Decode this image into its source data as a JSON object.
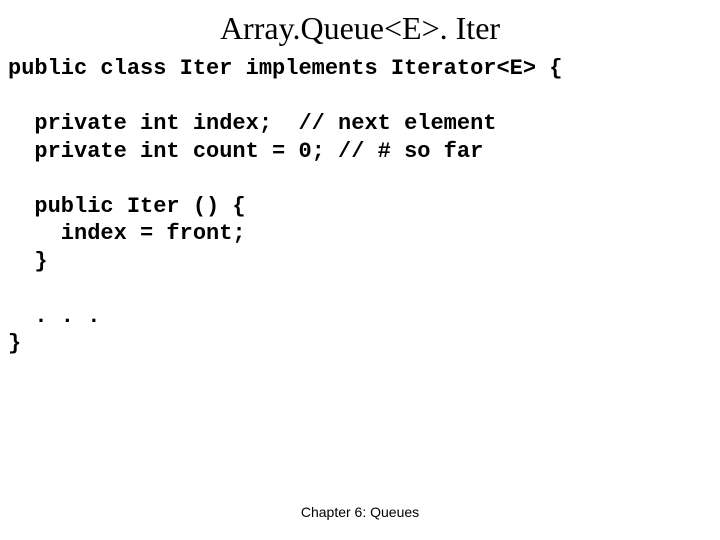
{
  "slide": {
    "title": "Array.Queue<E>. Iter",
    "code": {
      "line1": "public class Iter implements Iterator<E> {",
      "blank1": "",
      "line2": "  private int index;  // next element",
      "line3": "  private int count = 0; // # so far",
      "blank2": "",
      "line4": "  public Iter () {",
      "line5": "    index = front;",
      "line6": "  }",
      "blank3": "",
      "line7": "  . . .",
      "line8": "}"
    },
    "footer": "Chapter 6: Queues"
  }
}
